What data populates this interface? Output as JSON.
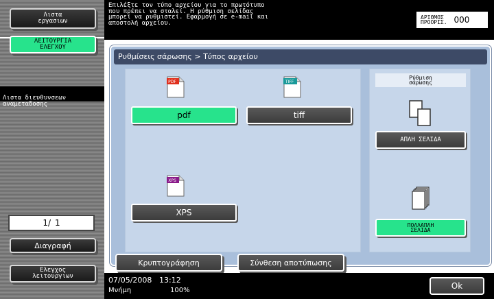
{
  "left_panel": {
    "job_list_label": "Λιστα\nεργασιων",
    "check_mode_label": "ΛΕΙΤΟΥΡΓΙΑ\nΕΛΕΓΧΟΥ",
    "address_list_label": "Λιστα διευθυνσεων\nαναμεταδοσης",
    "page_current": "1/",
    "page_total": "1",
    "delete_label": "Διαγραφή",
    "check_function_label": "Ελεγχος\nλειτουργιων"
  },
  "header": {
    "instruction": "Επιλέξτε τον τύπο αρχείου για το πρωτότυπο\nπου πρέπει να σταλεί. Η ρύθμιση σελίδας\nμπορεί να ρυθμιστεί. Εφαρμογή σε e-mail και\nαποστολή αρχείου.",
    "counter_label": "ΑΡΙΘΜΟΣ\nΠΡΟΟΡΙΣ.",
    "counter_value": "000"
  },
  "breadcrumb": "Ρυθμίσεις σάρωσης > Τύπος αρχείου",
  "file_types": {
    "pdf": {
      "label": "pdf",
      "icon_tag": "PDF",
      "selected": true,
      "icon_color": "#e0301e"
    },
    "tiff": {
      "label": "tiff",
      "icon_tag": "TIFF",
      "selected": false,
      "icon_color": "#1a9a9a"
    },
    "xps": {
      "label": "XPS",
      "icon_tag": "XPS",
      "selected": false,
      "icon_color": "#8a1a8a"
    }
  },
  "scan_setting": {
    "heading": "Ρύθμιση\nσάρωσης",
    "single_page_label": "ΑΠΛΗ ΣΕΛΙΔΑ",
    "multi_page_label": "ΠΟΛΛΑΠΛΗ\nΣΕΛΙΔΑ",
    "multi_page_selected": true
  },
  "bottom_buttons": {
    "encryption": "Κρυπτογράφηση",
    "composition": "Σύνθεση αποτύπωσης"
  },
  "status": {
    "date": "07/05/2008",
    "time": "13:12",
    "memory_label": "Μνήμη",
    "memory_value": "100%",
    "ok_label": "Ok"
  },
  "colors": {
    "accent_green": "#27e38c",
    "panel_blue": "#a9bfdb",
    "breadcrumb_bg": "#3d4a66"
  }
}
